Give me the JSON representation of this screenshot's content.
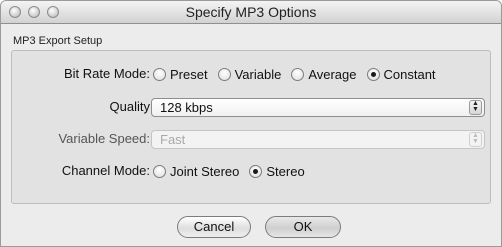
{
  "window": {
    "title": "Specify MP3 Options"
  },
  "group": {
    "label": "MP3 Export Setup"
  },
  "bit_rate_mode": {
    "label": "Bit Rate Mode:",
    "options": [
      {
        "label": "Preset",
        "selected": false
      },
      {
        "label": "Variable",
        "selected": false
      },
      {
        "label": "Average",
        "selected": false
      },
      {
        "label": "Constant",
        "selected": true
      }
    ]
  },
  "quality": {
    "label": "Quality",
    "value": "128 kbps"
  },
  "variable_speed": {
    "label": "Variable Speed:",
    "value": "Fast",
    "enabled": false
  },
  "channel_mode": {
    "label": "Channel Mode:",
    "options": [
      {
        "label": "Joint Stereo",
        "selected": false
      },
      {
        "label": "Stereo",
        "selected": true
      }
    ]
  },
  "buttons": {
    "cancel": "Cancel",
    "ok": "OK"
  }
}
